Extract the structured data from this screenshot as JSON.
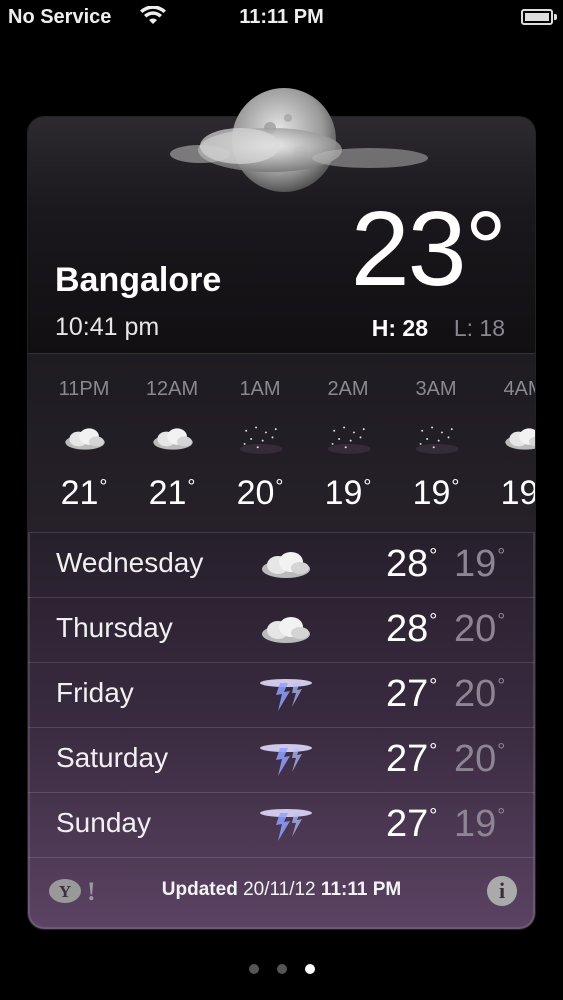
{
  "status_bar": {
    "carrier": "No Service",
    "time": "11:11 PM"
  },
  "location": {
    "city": "Bangalore",
    "local_time": "10:41 pm"
  },
  "current": {
    "temp": "23°",
    "high_label": "H:",
    "high": "28",
    "low_label": "L:",
    "low": "18"
  },
  "hourly": [
    {
      "time": "11PM",
      "temp": "21",
      "icon": "cloud-icon"
    },
    {
      "time": "12AM",
      "temp": "21",
      "icon": "cloud-icon"
    },
    {
      "time": "1AM",
      "temp": "20",
      "icon": "stars-icon"
    },
    {
      "time": "2AM",
      "temp": "19",
      "icon": "stars-icon"
    },
    {
      "time": "3AM",
      "temp": "19",
      "icon": "stars-icon"
    },
    {
      "time": "4AM",
      "temp": "19",
      "icon": "cloud-icon"
    }
  ],
  "daily": [
    {
      "day": "Wednesday",
      "high": "28",
      "low": "19",
      "icon": "cloud-icon"
    },
    {
      "day": "Thursday",
      "high": "28",
      "low": "20",
      "icon": "cloud-icon"
    },
    {
      "day": "Friday",
      "high": "27",
      "low": "20",
      "icon": "thunderstorm-icon"
    },
    {
      "day": "Saturday",
      "high": "27",
      "low": "20",
      "icon": "thunderstorm-icon"
    },
    {
      "day": "Sunday",
      "high": "27",
      "low": "19",
      "icon": "thunderstorm-icon"
    }
  ],
  "footer": {
    "updated_label": "Updated",
    "updated_date": "20/11/12",
    "updated_time": "11:11 PM",
    "yahoo": "Y!",
    "info": "i"
  },
  "pager": {
    "count": 3,
    "active": 2
  }
}
